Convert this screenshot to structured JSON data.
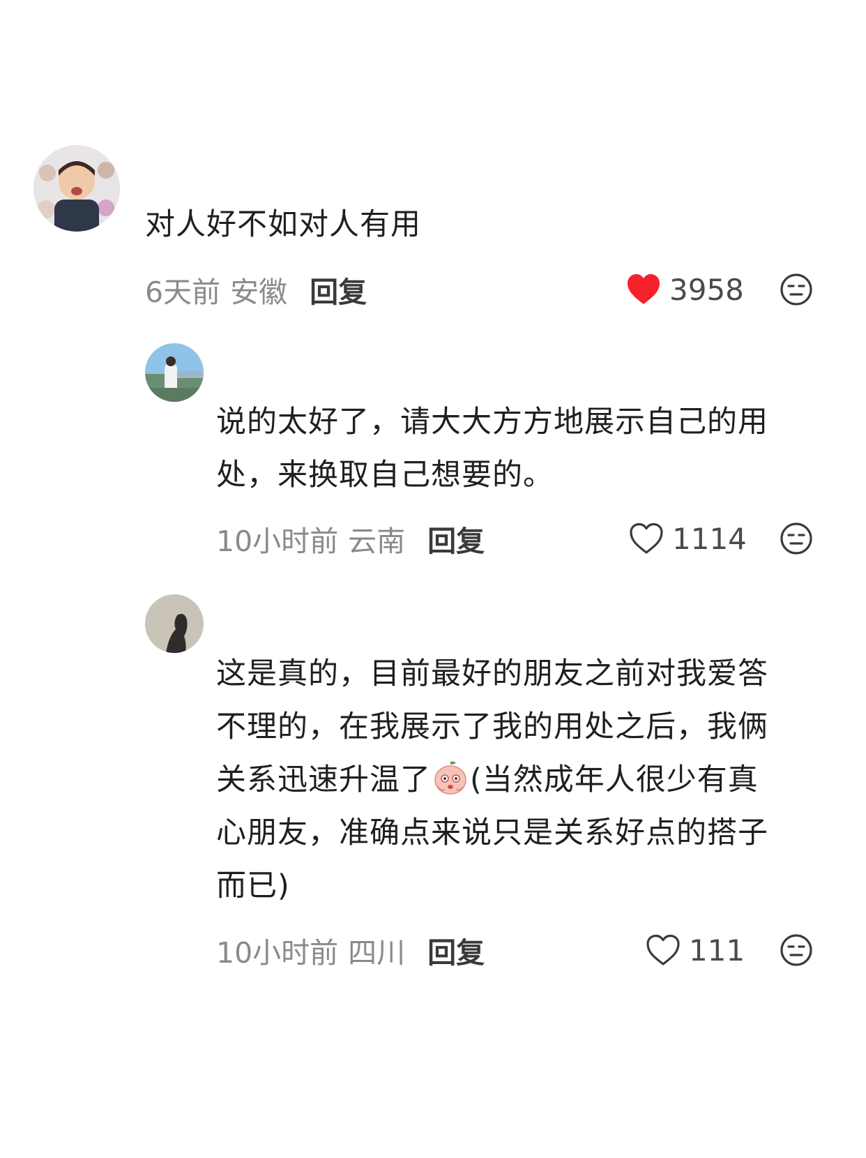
{
  "comments": [
    {
      "text": "对人好不如对人有用",
      "time": "6天前",
      "location": "安徽",
      "reply_label": "回复",
      "likes": "3958",
      "liked": true
    },
    {
      "text_lines": [
        "说的太好了，请大大方方地展示自己的用",
        "处，来换取自己想要的。"
      ],
      "time": "10小时前",
      "location": "云南",
      "reply_label": "回复",
      "likes": "1114",
      "liked": false
    },
    {
      "text_lines": [
        "这是真的，目前最好的朋友之前对我爱答",
        "不理的，在我展示了我的用处之后，我俩",
        "关系迅速升温了",
        "(当然成年人很少有真",
        "心朋友，准确点来说只是关系好点的搭子",
        "而已)"
      ],
      "time": "10小时前",
      "location": "四川",
      "reply_label": "回复",
      "likes": "111",
      "liked": false
    }
  ],
  "colors": {
    "like_active": "#f5222d",
    "meta_gray": "#8a8a8a",
    "text": "#1f1f1f"
  }
}
